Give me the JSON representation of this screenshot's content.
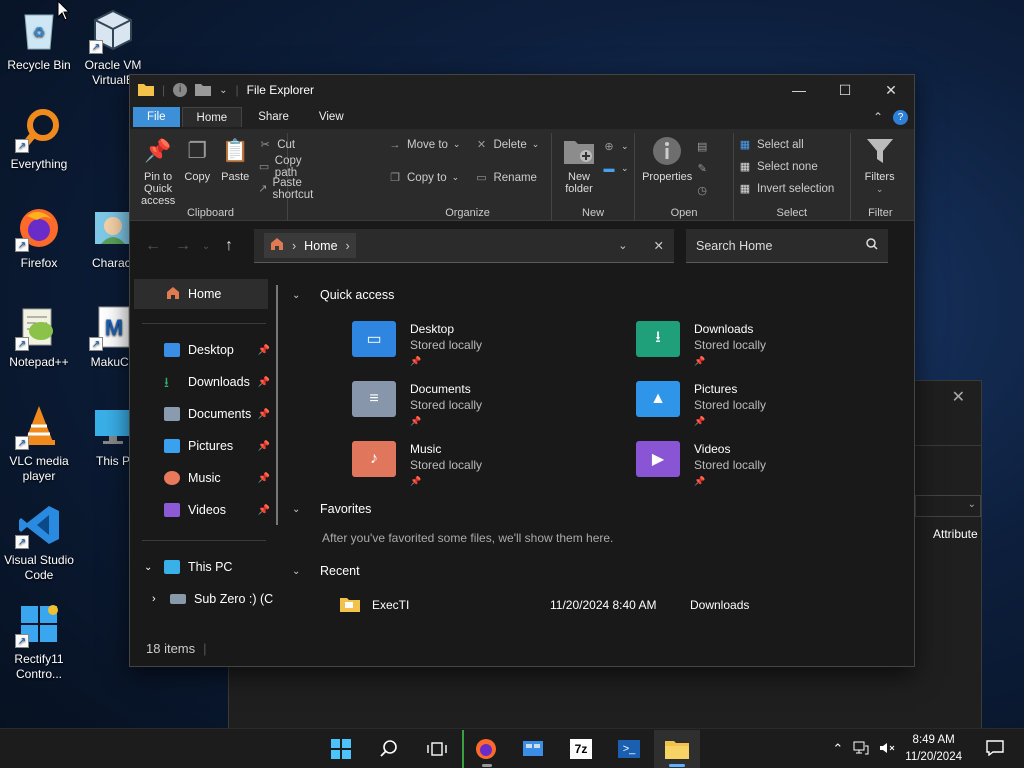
{
  "desktop": {
    "icons": [
      {
        "label": "Recycle Bin",
        "icon": "recycle-bin-icon"
      },
      {
        "label": "Oracle VM VirtualB",
        "icon": "virtualbox-icon"
      },
      {
        "label": "Everything",
        "icon": "everything-search-icon"
      },
      {
        "label": "Firefox",
        "icon": "firefox-icon"
      },
      {
        "label": "Charact",
        "icon": "character-app-icon"
      },
      {
        "label": "Notepad++",
        "icon": "notepadpp-icon"
      },
      {
        "label": "MakuCh",
        "icon": "makuch-icon"
      },
      {
        "label": "VLC media player",
        "icon": "vlc-icon"
      },
      {
        "label": "This P",
        "icon": "this-pc-icon"
      },
      {
        "label": "Visual Studio Code",
        "icon": "vscode-icon"
      },
      {
        "label": "Rectify11 Contro...",
        "icon": "rectify11-icon"
      }
    ]
  },
  "background_window": {
    "column_header": "Attribute"
  },
  "explorer": {
    "title": "File Explorer",
    "tabs": [
      "File",
      "Home",
      "Share",
      "View"
    ],
    "ribbon": {
      "clipboard": {
        "label": "Clipboard",
        "pin": "Pin to Quick access",
        "copy": "Copy",
        "paste": "Paste",
        "cut": "Cut",
        "copy_path": "Copy path",
        "paste_shortcut": "Paste shortcut"
      },
      "organize": {
        "label": "Organize",
        "move_to": "Move to",
        "copy_to": "Copy to",
        "delete": "Delete",
        "rename": "Rename"
      },
      "new": {
        "label": "New",
        "new_folder": "New folder"
      },
      "open": {
        "label": "Open",
        "properties": "Properties"
      },
      "select": {
        "label": "Select",
        "select_all": "Select all",
        "select_none": "Select none",
        "invert": "Invert selection"
      },
      "filter": {
        "label": "Filter",
        "filters": "Filters"
      }
    },
    "address": {
      "crumb": "Home"
    },
    "search": {
      "placeholder": "Search Home"
    },
    "nav": {
      "home": "Home",
      "pinned": [
        {
          "label": "Desktop",
          "color": "#3a8ee6"
        },
        {
          "label": "Downloads",
          "color": "#2fb36b"
        },
        {
          "label": "Documents",
          "color": "#8a9bb0"
        },
        {
          "label": "Pictures",
          "color": "#3aa0f0"
        },
        {
          "label": "Music",
          "color": "#e8795a"
        },
        {
          "label": "Videos",
          "color": "#8d5ad6"
        }
      ],
      "this_pc": "This PC",
      "drive": "Sub Zero :) (C"
    },
    "content": {
      "quick_access": "Quick access",
      "items": [
        {
          "name": "Desktop",
          "sub": "Stored locally",
          "color": "#2f86e0",
          "icon": "desktop-folder-icon"
        },
        {
          "name": "Downloads",
          "sub": "Stored locally",
          "color": "#20a07a",
          "icon": "downloads-folder-icon"
        },
        {
          "name": "Documents",
          "sub": "Stored locally",
          "color": "#8796aa",
          "icon": "documents-folder-icon"
        },
        {
          "name": "Pictures",
          "sub": "Stored locally",
          "color": "#2f95e8",
          "icon": "pictures-folder-icon"
        },
        {
          "name": "Music",
          "sub": "Stored locally",
          "color": "#e0765c",
          "icon": "music-folder-icon"
        },
        {
          "name": "Videos",
          "sub": "Stored locally",
          "color": "#8a55d4",
          "icon": "videos-folder-icon"
        }
      ],
      "favorites": "Favorites",
      "favorites_msg": "After you've favorited some files, we'll show them here.",
      "recent": "Recent",
      "recent_items": [
        {
          "name": "ExecTI",
          "date": "11/20/2024 8:40 AM",
          "location": "Downloads"
        }
      ]
    },
    "status": "18 items"
  },
  "taskbar": {
    "time": "8:49 AM",
    "date": "11/20/2024"
  }
}
